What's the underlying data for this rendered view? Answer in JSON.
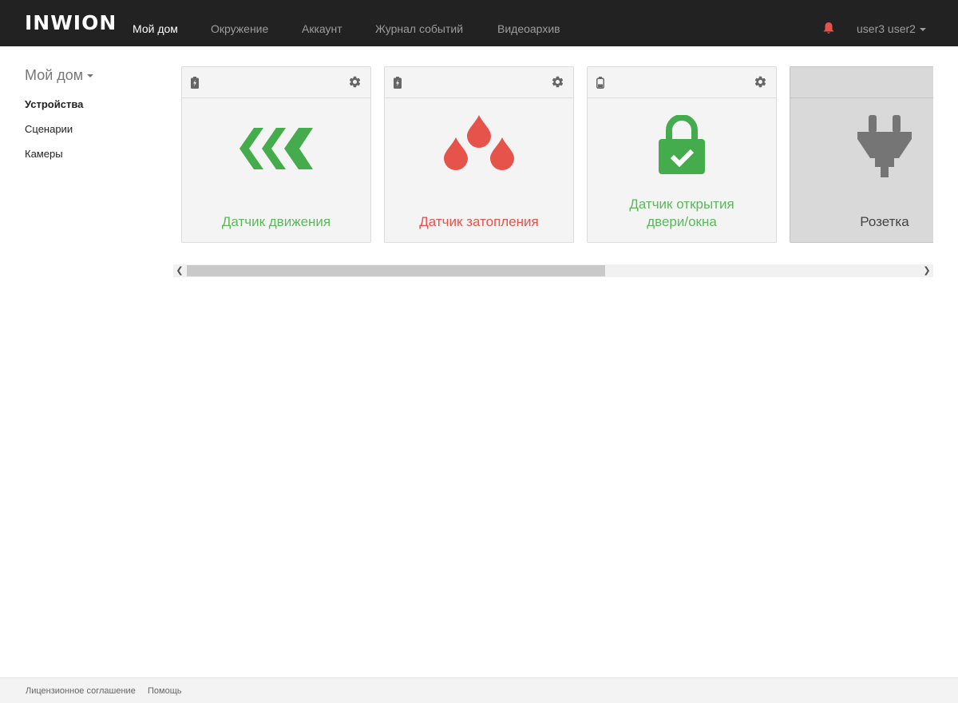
{
  "header": {
    "logo": "INWION",
    "nav": [
      {
        "label": "Мой дом",
        "active": true
      },
      {
        "label": "Окружение",
        "active": false
      },
      {
        "label": "Аккаунт",
        "active": false
      },
      {
        "label": "Журнал событий",
        "active": false
      },
      {
        "label": "Видеоархив",
        "active": false
      }
    ],
    "bell_icon": "bell-icon",
    "user": "user3 user2"
  },
  "sidebar": {
    "title": "Мой дом",
    "items": [
      {
        "label": "Устройства",
        "active": true
      },
      {
        "label": "Сценарии",
        "active": false
      },
      {
        "label": "Камеры",
        "active": false
      }
    ]
  },
  "devices": [
    {
      "label": "Датчик движения",
      "icon": "motion-chevrons-icon",
      "color": "#5cb85c",
      "battery": "charging"
    },
    {
      "label": "Датчик затопления",
      "icon": "water-drops-icon",
      "color": "#e5534b",
      "battery": "charging"
    },
    {
      "label_line1": "Датчик открытия",
      "label_line2": "двери/окна",
      "icon": "lock-check-icon",
      "color": "#5cb85c",
      "battery": "low"
    },
    {
      "label": "Розетка",
      "icon": "plug-icon",
      "color": "#444444",
      "state": "off"
    }
  ],
  "colors": {
    "navbar": "#222222",
    "green": "#44ac4c",
    "red": "#e5534b",
    "gray": "#777777"
  },
  "footer": {
    "links": [
      "Лицензионное соглашение",
      "Помощь"
    ]
  }
}
